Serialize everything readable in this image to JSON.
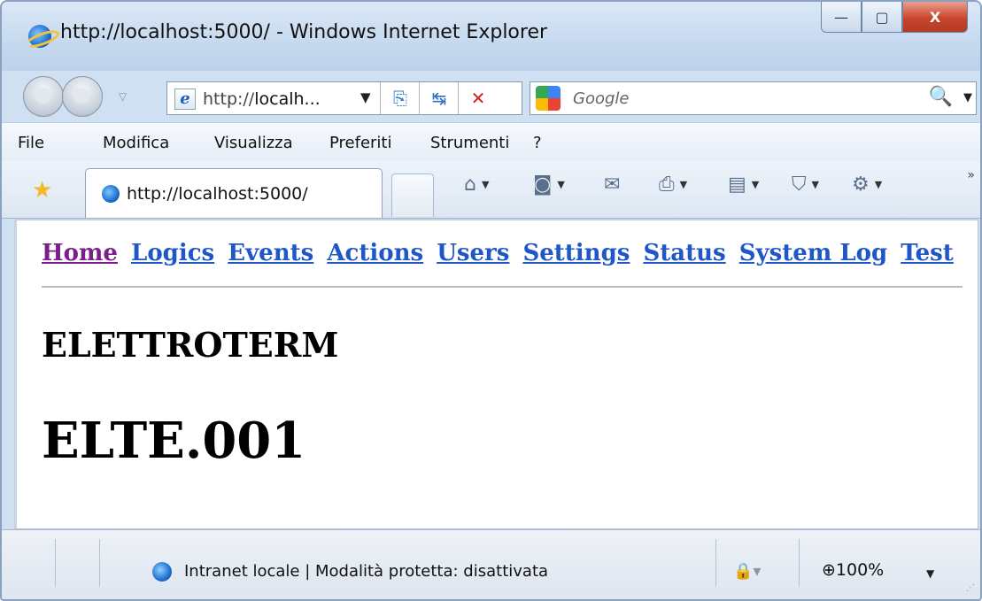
{
  "window": {
    "title": "http://localhost:5000/ - Windows Internet Explorer",
    "buttons": {
      "minimize": "—",
      "maximize": "▢",
      "close": "X"
    }
  },
  "address_bar": {
    "text_prefix": "http://",
    "text_host": "localh...",
    "dropdown": "▼"
  },
  "search": {
    "placeholder": "Google",
    "icon": "🔍",
    "dropdown": "▼"
  },
  "menu": [
    "File",
    "Modifica",
    "Visualizza",
    "Preferiti",
    "Strumenti",
    "?"
  ],
  "tab": {
    "label": "http://localhost:5000/"
  },
  "page": {
    "nav": [
      "Home",
      "Logics",
      "Events",
      "Actions",
      "Users",
      "Settings",
      "Status",
      "System Log",
      "Test"
    ],
    "company": "ELETTROTERM",
    "device": "ELTE.001"
  },
  "status": {
    "zone": "Intranet locale | Modalità protetta: disattivata",
    "zoom": "100%"
  },
  "colors": {
    "link": "#1f57c9",
    "visited_link": "#7a1f8a",
    "frame": "#cfe0f3"
  }
}
